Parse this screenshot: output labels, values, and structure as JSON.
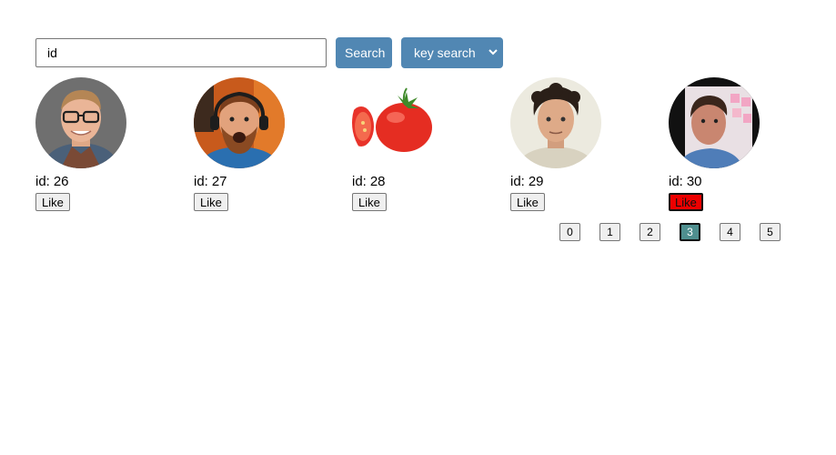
{
  "search": {
    "input_value": "id",
    "search_label": "Search",
    "mode_select_value": "key search"
  },
  "cards": [
    {
      "id_label": "id:",
      "id_value": "26",
      "like_label": "Like",
      "liked": false,
      "avatar_icon": "man-glasses-portrait"
    },
    {
      "id_label": "id:",
      "id_value": "27",
      "like_label": "Like",
      "liked": false,
      "avatar_icon": "man-headphones-portrait"
    },
    {
      "id_label": "id:",
      "id_value": "28",
      "like_label": "Like",
      "liked": false,
      "avatar_icon": "tomato-image"
    },
    {
      "id_label": "id:",
      "id_value": "29",
      "like_label": "Like",
      "liked": false,
      "avatar_icon": "man-curly-hair-portrait"
    },
    {
      "id_label": "id:",
      "id_value": "30",
      "like_label": "Like",
      "liked": true,
      "avatar_icon": "man-whiteboard-portrait"
    }
  ],
  "pagination": {
    "pages": [
      "0",
      "1",
      "2",
      "3",
      "4",
      "5"
    ],
    "current": "3"
  },
  "colors": {
    "accent": "#5187b3",
    "liked": "#ee0000",
    "active_page": "#4f8f8f"
  }
}
